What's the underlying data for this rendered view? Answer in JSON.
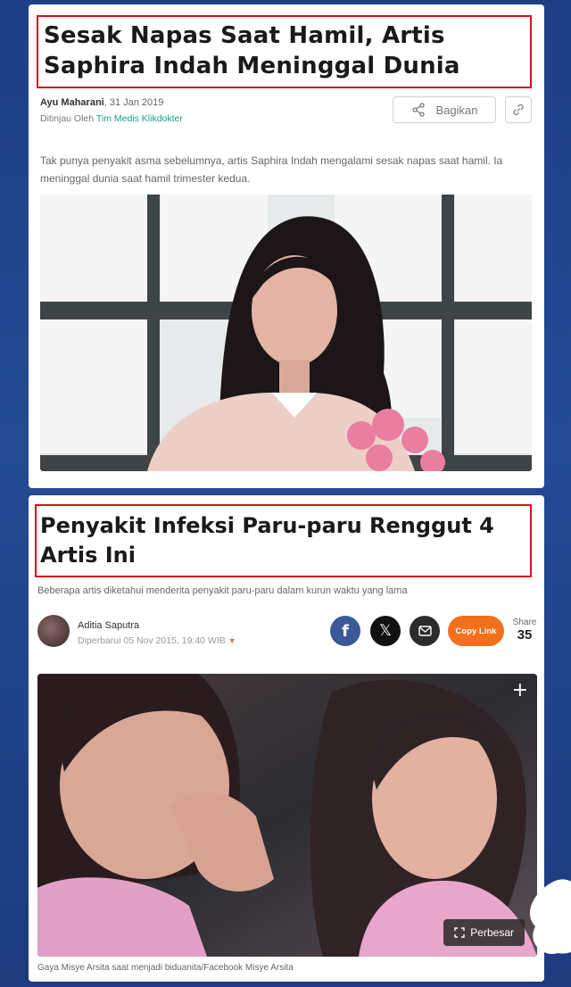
{
  "article1": {
    "headline": "Sesak Napas Saat Hamil, Artis Saphira Indah Meninggal Dunia",
    "author": "Ayu Maharani",
    "date": ", 31 Jan 2019",
    "reviewed_prefix": "Ditinjau Oleh ",
    "reviewed_by": "Tim Medis Klikdokter",
    "share_label": "Bagikan",
    "lead": "Tak punya penyakit asma sebelumnya, artis Saphira Indah mengalami sesak napas saat hamil. Ia meninggal dunia saat hamil trimester kedua.",
    "icons": {
      "share": "share-icon",
      "link": "link-icon"
    }
  },
  "article2": {
    "headline": "Penyakit Infeksi Paru-paru Renggut 4 Artis Ini",
    "subtitle": "Beberapa artis diketahui menderita penyakit paru-paru dalam kurun waktu yang lama",
    "author": "Aditia Saputra",
    "updated": "Diperbarui 05 Nov 2015, 19:40 WIB",
    "social": {
      "facebook": "f",
      "x": "𝕏",
      "copy_label": "Copy Link"
    },
    "share_label": "Share",
    "share_count": "35",
    "enlarge_label": "Perbesar",
    "plus": "+",
    "caption": "Gaya Misye Arsita saat menjadi biduanita/Facebook Misye Arsita"
  },
  "colors": {
    "highlight_border": "#d0121b",
    "reviewer_link": "#1a9e8a",
    "copy_link": "#f26f1c",
    "facebook": "#3b5998",
    "background": "#244a94"
  }
}
